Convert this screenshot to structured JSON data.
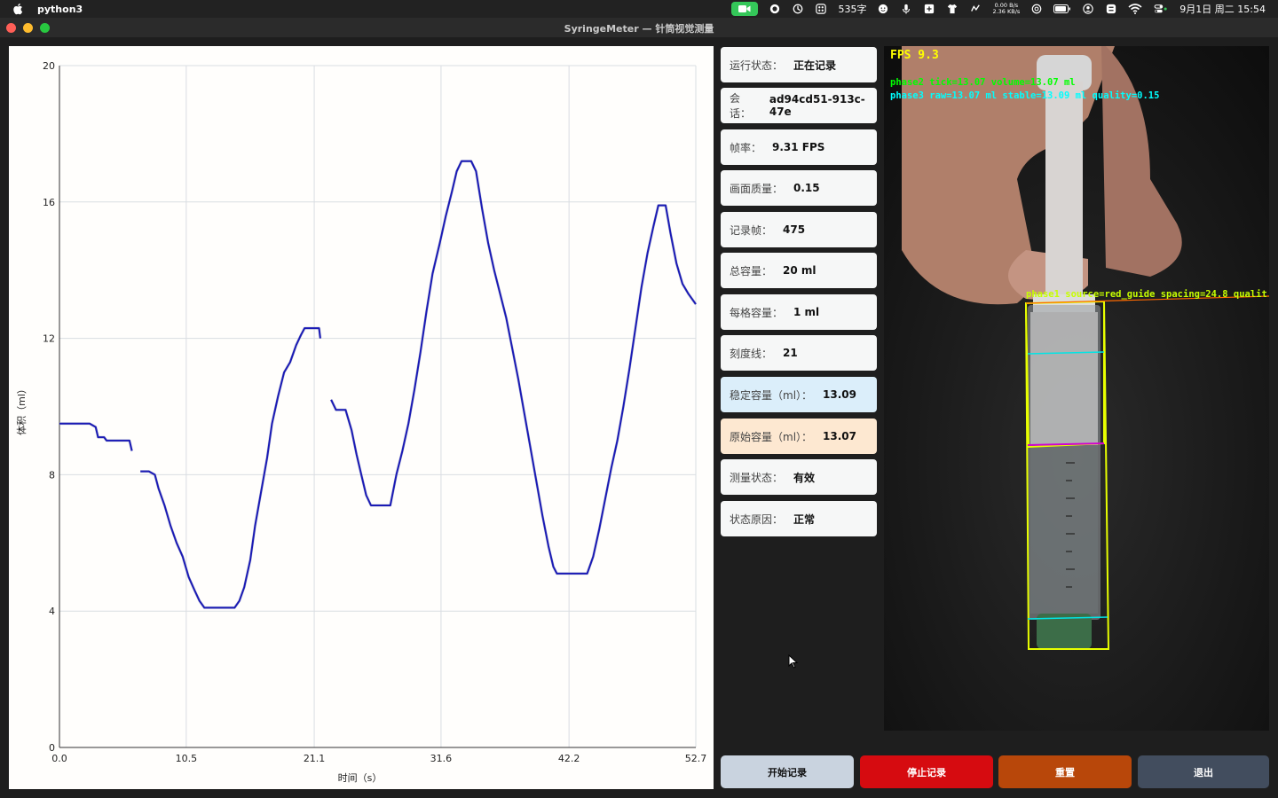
{
  "menubar": {
    "app_name": "python3",
    "char_count": "535字",
    "net_up": "0.00 B/s",
    "net_down": "2.36 KB/s",
    "datetime": "9月1日 周二  15:54"
  },
  "window": {
    "title": "SyringeMeter — 针筒视觉测量"
  },
  "info": [
    {
      "label": "运行状态：",
      "value": "正在记录"
    },
    {
      "label": "会话：",
      "value": "ad94cd51-913c-47e"
    },
    {
      "label": "帧率：",
      "value": "9.31 FPS"
    },
    {
      "label": "画面质量：",
      "value": "0.15"
    },
    {
      "label": "记录帧：",
      "value": "475"
    },
    {
      "label": "总容量：",
      "value": "20 ml"
    },
    {
      "label": "每格容量：",
      "value": "1 ml"
    },
    {
      "label": "刻度线：",
      "value": "21"
    },
    {
      "label": "稳定容量（ml）：",
      "value": "13.09"
    },
    {
      "label": "原始容量（ml）：",
      "value": "13.07"
    },
    {
      "label": "测量状态：",
      "value": "有效"
    },
    {
      "label": "状态原因：",
      "value": "正常"
    }
  ],
  "colors": {
    "info_default": "#f6f7f7",
    "info_stable": "#dbeefa",
    "info_raw": "#fde8d1",
    "line": "#1a1ab5",
    "btn_start": "#c9d3df",
    "btn_stop": "#d60b10",
    "btn_reset": "#b8470a",
    "btn_exit": "#424d5e"
  },
  "buttons": {
    "start": "开始记录",
    "stop": "停止记录",
    "reset": "重置",
    "exit": "退出"
  },
  "camera": {
    "fps": "FPS 9.3",
    "phase2": "phase2 tick=13.07 volume=13.07 ml",
    "phase3": "phase3 raw=13.07 ml stable=13.09 ml quality=0.15",
    "phase1": "phase1 source=red_guide spacing=24.8 qualit"
  },
  "chart_data": {
    "type": "line",
    "xlabel": "时间（s）",
    "ylabel": "体积（ml）",
    "xlim": [
      0,
      52.7
    ],
    "ylim": [
      0,
      20
    ],
    "xticks": [
      "0.0",
      "10.5",
      "21.1",
      "31.6",
      "42.2",
      "52.7"
    ],
    "yticks": [
      "0",
      "4",
      "8",
      "12",
      "16",
      "20"
    ],
    "grid": true,
    "segments": [
      [
        [
          0,
          9.5
        ],
        [
          2.5,
          9.5
        ],
        [
          3.0,
          9.4
        ],
        [
          3.2,
          9.1
        ],
        [
          3.7,
          9.1
        ],
        [
          3.9,
          9.0
        ],
        [
          5.8,
          9.0
        ],
        [
          6.0,
          8.7
        ]
      ],
      [
        [
          6.7,
          8.1
        ],
        [
          7.4,
          8.1
        ],
        [
          7.9,
          8.0
        ],
        [
          8.2,
          7.6
        ],
        [
          8.7,
          7.1
        ],
        [
          9.2,
          6.5
        ],
        [
          9.7,
          6.0
        ],
        [
          10.2,
          5.6
        ],
        [
          10.7,
          5.0
        ],
        [
          11.2,
          4.6
        ],
        [
          11.6,
          4.3
        ],
        [
          12.0,
          4.1
        ],
        [
          14.5,
          4.1
        ],
        [
          14.9,
          4.3
        ],
        [
          15.3,
          4.7
        ],
        [
          15.8,
          5.5
        ],
        [
          16.2,
          6.5
        ],
        [
          16.7,
          7.5
        ],
        [
          17.2,
          8.5
        ],
        [
          17.6,
          9.5
        ],
        [
          18.1,
          10.3
        ],
        [
          18.6,
          11.0
        ],
        [
          19.1,
          11.3
        ],
        [
          19.6,
          11.8
        ],
        [
          20.0,
          12.1
        ],
        [
          20.3,
          12.3
        ],
        [
          21.5,
          12.3
        ],
        [
          21.6,
          12.0
        ]
      ],
      [
        [
          22.5,
          10.2
        ],
        [
          22.9,
          9.9
        ],
        [
          23.7,
          9.9
        ],
        [
          24.2,
          9.3
        ],
        [
          24.6,
          8.6
        ],
        [
          25.0,
          8.0
        ],
        [
          25.4,
          7.4
        ],
        [
          25.8,
          7.1
        ],
        [
          27.4,
          7.1
        ],
        [
          27.9,
          8.0
        ],
        [
          28.4,
          8.7
        ],
        [
          28.9,
          9.5
        ],
        [
          29.4,
          10.5
        ],
        [
          29.9,
          11.6
        ],
        [
          30.4,
          12.8
        ],
        [
          30.9,
          13.9
        ],
        [
          31.5,
          14.8
        ],
        [
          32.0,
          15.6
        ],
        [
          32.5,
          16.3
        ],
        [
          32.9,
          16.9
        ],
        [
          33.3,
          17.2
        ],
        [
          34.1,
          17.2
        ],
        [
          34.5,
          16.9
        ],
        [
          35.0,
          15.8
        ],
        [
          35.5,
          14.8
        ],
        [
          36.0,
          14.0
        ],
        [
          36.5,
          13.3
        ],
        [
          37.0,
          12.6
        ],
        [
          37.5,
          11.7
        ],
        [
          38.0,
          10.8
        ],
        [
          38.5,
          9.8
        ],
        [
          39.0,
          8.8
        ],
        [
          39.5,
          7.8
        ],
        [
          40.0,
          6.8
        ],
        [
          40.5,
          5.9
        ],
        [
          40.9,
          5.3
        ],
        [
          41.2,
          5.1
        ],
        [
          43.7,
          5.1
        ],
        [
          44.2,
          5.6
        ],
        [
          44.7,
          6.4
        ],
        [
          45.2,
          7.3
        ],
        [
          45.7,
          8.2
        ],
        [
          46.2,
          9.0
        ],
        [
          46.7,
          10.0
        ],
        [
          47.2,
          11.1
        ],
        [
          47.7,
          12.3
        ],
        [
          48.2,
          13.5
        ],
        [
          48.7,
          14.5
        ],
        [
          49.2,
          15.3
        ],
        [
          49.6,
          15.9
        ],
        [
          50.2,
          15.9
        ],
        [
          50.6,
          15.1
        ],
        [
          51.1,
          14.2
        ],
        [
          51.6,
          13.6
        ],
        [
          52.1,
          13.3
        ],
        [
          52.7,
          13.0
        ]
      ]
    ]
  }
}
